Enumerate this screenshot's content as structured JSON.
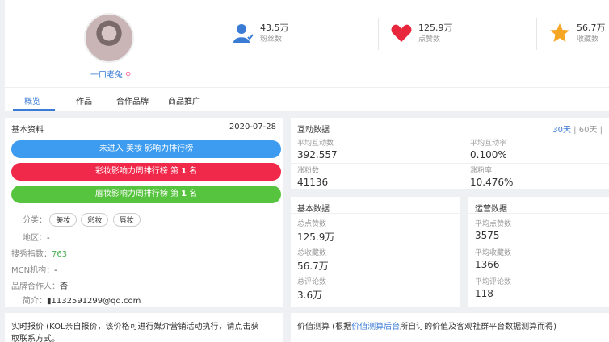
{
  "profile": {
    "name": "一口老兔",
    "gender_symbol": "♀"
  },
  "stats": [
    {
      "value": "43.5万",
      "label": "粉丝数",
      "icon": "user-icon",
      "color": "#3a7bd5"
    },
    {
      "value": "125.9万",
      "label": "点赞数",
      "icon": "heart-icon",
      "color": "#e8263c"
    },
    {
      "value": "56.7万",
      "label": "收藏数",
      "icon": "star-icon",
      "color": "#f5a623"
    }
  ],
  "tabs": [
    "概览",
    "作品",
    "合作品牌",
    "商品推广"
  ],
  "basic": {
    "title": "基本资料",
    "date": "2020-07-28",
    "rank1": {
      "pre": "未进入 美妆 影响力排行榜"
    },
    "rank2": {
      "pre": "彩妆影响力周排行榜 第",
      "num": "1",
      "post": "名"
    },
    "rank3": {
      "pre": "唇妆影响力周排行榜 第",
      "num": "1",
      "post": "名"
    },
    "category_label": "分类：",
    "categories": [
      "美妆",
      "彩妆",
      "唇妆"
    ],
    "region_label": "地区：",
    "region": "-",
    "index_label": "搜秀指数：",
    "index": "763",
    "mcn_label": "MCN机构：",
    "mcn": "-",
    "brand_label": "品牌合作人：",
    "brand": "否",
    "intro_label": "简介：",
    "intro": "1132591299@qq.com"
  },
  "interaction": {
    "title": "互动数据",
    "period_30": "30天",
    "period_sep": "|",
    "period_60": "60天",
    "period_sep2": "|",
    "avg_inter_label": "平均互动数",
    "avg_inter": "392.557",
    "avg_rate_label": "平均互动率",
    "avg_rate": "0.100%",
    "fans_label": "涨粉数",
    "fans": "41136",
    "fans_rate_label": "涨粉率",
    "fans_rate": "10.476%"
  },
  "basicdata": {
    "title": "基本数据",
    "likes_label": "总点赞数",
    "likes": "125.9万",
    "fav_label": "总收藏数",
    "fav": "56.7万",
    "comments_label": "总评论数",
    "comments": "3.6万"
  },
  "ops": {
    "title": "运营数据",
    "avg_likes_label": "平均点赞数",
    "avg_likes": "3575",
    "avg_fav_label": "平均收藏数",
    "avg_fav": "1366",
    "avg_comments_label": "平均评论数",
    "avg_comments": "118"
  },
  "bottom": {
    "quote_line1": "实时报价 (KOL亲自报价，该价格可进行媒介营销活动执行，请点击获",
    "quote_line2": "取联系方式。",
    "value_pre": "价值测算 (根据",
    "value_link": "价值测算后台",
    "value_post": "所自订的价值及客观社群平台数据测算而得)"
  }
}
